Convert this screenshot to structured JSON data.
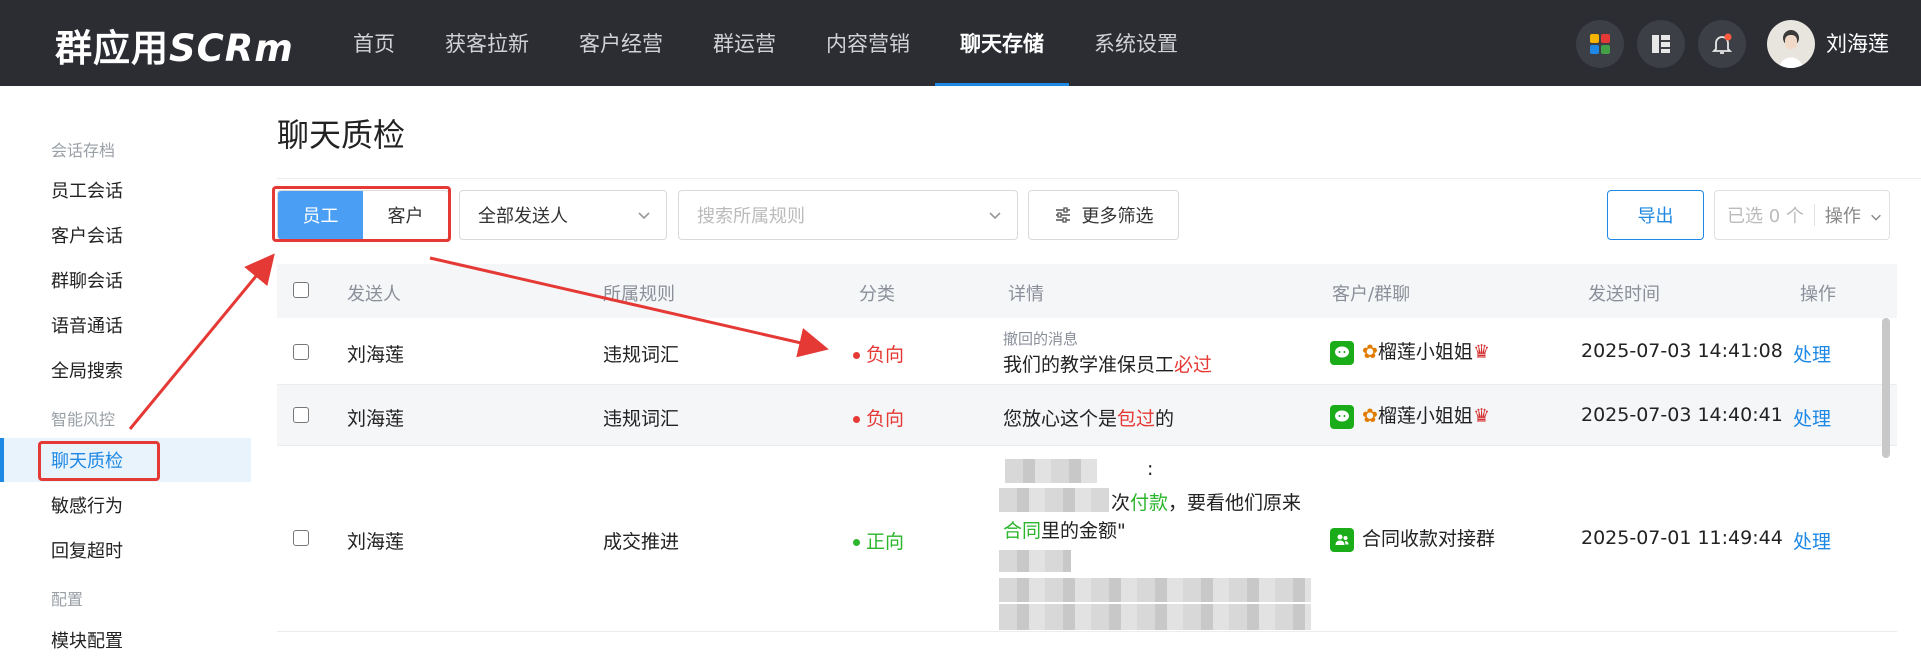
{
  "app": {
    "logo_cn": "群应用",
    "logo_en": "SCRm",
    "user_name": "刘海莲"
  },
  "nav": {
    "items": [
      "首页",
      "获客拉新",
      "客户经营",
      "群运营",
      "内容营销",
      "聊天存储",
      "系统设置"
    ],
    "active": "聊天存储"
  },
  "sidebar": {
    "group1": "会话存档",
    "group2": "智能风控",
    "group3": "配置",
    "items": [
      "员工会话",
      "客户会话",
      "群聊会话",
      "语音通话",
      "全局搜索",
      "聊天质检",
      "敏感行为",
      "回复超时",
      "模块配置"
    ],
    "active": "聊天质检"
  },
  "page": {
    "title": "聊天质检"
  },
  "filters": {
    "tab_employee": "员工",
    "tab_customer": "客户",
    "sender_select": "全部发送人",
    "rule_placeholder": "搜索所属规则",
    "more_filters": "更多筛选",
    "export": "导出",
    "selected": "已选 0 个",
    "action": "操作"
  },
  "table": {
    "headers": {
      "sender": "发送人",
      "rule": "所属规则",
      "category": "分类",
      "detail": "详情",
      "customer": "客户/群聊",
      "time": "发送时间",
      "op": "操作"
    },
    "rows": [
      {
        "sender": "刘海莲",
        "rule": "违规词汇",
        "category": "负向",
        "detail_tag": "撤回的消息",
        "detail_text": "我们的教学准保员工",
        "detail_hl": "必过",
        "detail_after": "",
        "customer": "榴莲小姐姐",
        "time": "2025-07-03 14:41:08",
        "op": "处理"
      },
      {
        "sender": "刘海莲",
        "rule": "违规词汇",
        "category": "负向",
        "detail_text": "您放心这个是",
        "detail_hl": "包过",
        "detail_after": "的",
        "customer": "榴莲小姐姐",
        "time": "2025-07-03 14:40:41",
        "op": "处理"
      },
      {
        "sender": "刘海莲",
        "rule": "成交推进",
        "category": "正向",
        "detail_colon": ":",
        "detail_a": "次",
        "detail_hl1": "付款",
        "detail_b": "，要看他们原来",
        "detail_hl2": "合同",
        "detail_c": "里的金额\"",
        "customer": "合同收款对接群",
        "time": "2025-07-01 11:49:44",
        "op": "处理"
      }
    ]
  },
  "colors": {
    "topbar": "#2b2d33",
    "accent": "#1e88e5",
    "negative": "#e53935",
    "positive": "#2db52d",
    "annotation": "#e53935"
  }
}
